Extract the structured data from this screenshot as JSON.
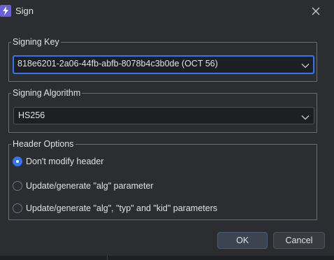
{
  "window": {
    "title": "Sign",
    "accent_color": "#3574f0"
  },
  "signing_key": {
    "legend": "Signing Key",
    "selected": "818e6201-2a06-44fb-abfb-8078b4c3b0de (OCT 56)"
  },
  "signing_algorithm": {
    "legend": "Signing Algorithm",
    "selected": "HS256"
  },
  "header_options": {
    "legend": "Header Options",
    "options": [
      {
        "label": "Don't modify header",
        "checked": true
      },
      {
        "label": "Update/generate \"alg\" parameter",
        "checked": false
      },
      {
        "label": "Update/generate \"alg\", \"typ\" and \"kid\" parameters",
        "checked": false
      }
    ]
  },
  "buttons": {
    "ok": "OK",
    "cancel": "Cancel"
  },
  "icons": {
    "app": "lightning-icon",
    "close": "close-icon",
    "dropdown": "chevron-down-icon"
  }
}
